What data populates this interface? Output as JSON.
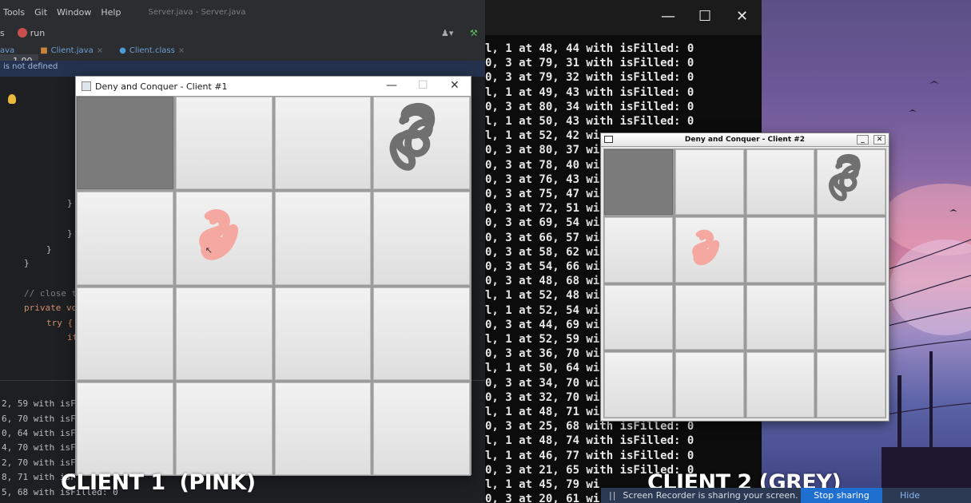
{
  "ide": {
    "menu": [
      "Tools",
      "Git",
      "Window",
      "Help"
    ],
    "window_title": "Server.java - Server.java",
    "toolbar_prefix": "s",
    "run_label": "run",
    "tabs": [
      {
        "label": "ava"
      },
      {
        "label": "Client.java"
      },
      {
        "label": "Client.class"
      }
    ],
    "zoom": "1.00",
    "banner": "is not defined",
    "code_lines": [
      "}",
      "}",
      "}",
      "}",
      "// close t",
      "private vo",
      "try {",
      "it"
    ],
    "console_lines": [
      "2, 59 with isF",
      "6, 70 with isF",
      "0, 64 with isF",
      "4, 70 with isF",
      "2, 70 with isF",
      "8, 71 with isF",
      "5, 68 with isFilled: 0"
    ]
  },
  "terminal": {
    "minimize": "—",
    "maximize": "☐",
    "close": "✕",
    "lines": [
      "l, 1 at 48, 44 with isFilled: 0",
      "0, 3 at 79, 31 with isFilled: 0",
      "0, 3 at 79, 32 with isFilled: 0",
      "l, 1 at 49, 43 with isFilled: 0",
      "0, 3 at 80, 34 with isFilled: 0",
      "l, 1 at 50, 43 with isFilled: 0",
      "l, 1 at 52, 42 wi",
      "0, 3 at 80, 37 wi",
      "0, 3 at 78, 40 wi",
      "0, 3 at 76, 43 wi",
      "0, 3 at 75, 47 wi",
      "0, 3 at 72, 51 wi",
      "0, 3 at 69, 54 wi",
      "0, 3 at 66, 57 wi",
      "0, 3 at 58, 62 wi",
      "0, 3 at 54, 66 wi",
      "0, 3 at 48, 68 wi",
      "l, 1 at 52, 48 wi",
      "l, 1 at 52, 54 wi",
      "0, 3 at 44, 69 wi",
      "l, 1 at 52, 59 wi",
      "0, 3 at 36, 70 wi",
      "l, 1 at 50, 64 wi",
      "0, 3 at 34, 70 wi",
      "0, 3 at 32, 70 wi",
      "l, 1 at 48, 71 wi",
      "0, 3 at 25, 68 with isFilled: 0",
      "l, 1 at 48, 74 with isFilled: 0",
      "l, 1 at 46, 77 with isFilled: 0",
      "0, 3 at 21, 65 with isFilled: 0",
      "l, 1 at 45, 79 wi",
      "0, 3 at 20, 61 wi"
    ]
  },
  "client1": {
    "title": "Deny and Conquer - Client #1",
    "controls": {
      "minimize": "—",
      "maximize": "☐",
      "close": "✕"
    },
    "colors": {
      "filled": "#7b7b7b",
      "grey_scribble": "#707070",
      "pink_scribble": "#f4a8a0"
    }
  },
  "client2": {
    "title": "Deny and Conquer - Client #2",
    "controls": {
      "minimize": "_",
      "close": "✕"
    }
  },
  "captions": {
    "client1": "CLIENT 1  (PINK)",
    "client2": "CLIENT 2 (GREY)"
  },
  "sharebar": {
    "pause": "||",
    "message": "Screen Recorder is sharing your screen.",
    "stop": "Stop sharing",
    "hide": "Hide"
  }
}
